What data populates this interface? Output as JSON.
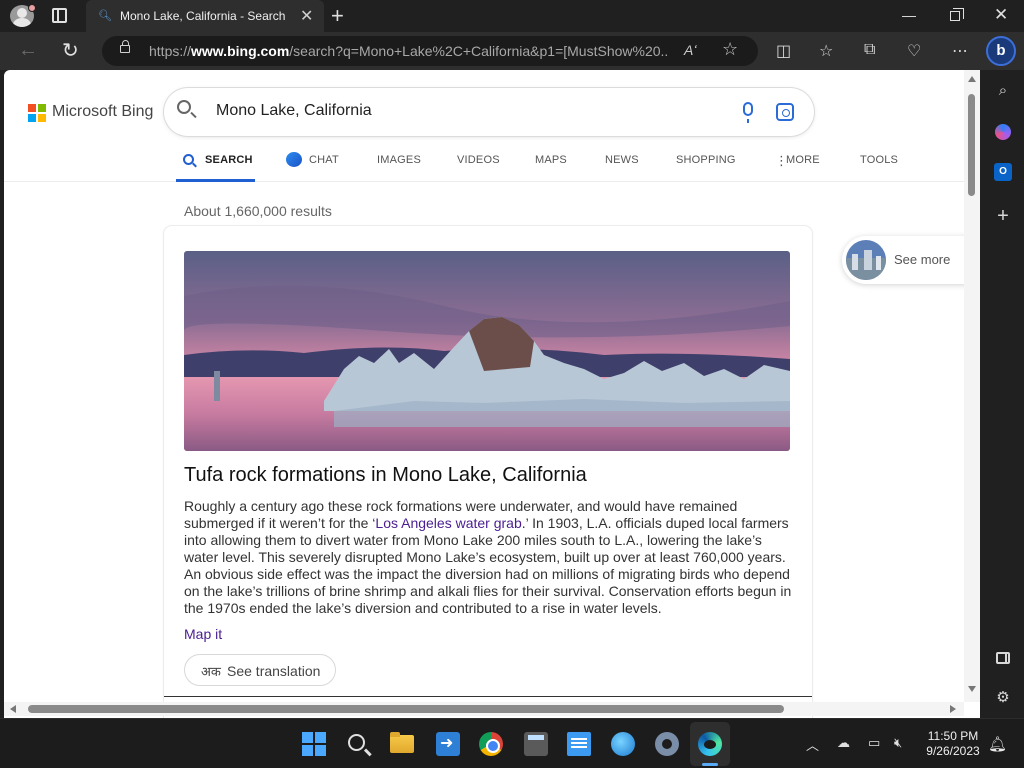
{
  "browser": {
    "tab_title": "Mono Lake, California - Search",
    "url_prefix": "https://",
    "url_domain": "www.bing.com",
    "url_rest": "/search?q=Mono+Lake%2C+California&p1=[MustShow%20...",
    "read_aloud_glyph": "Aʻ"
  },
  "bing": {
    "logo_text": "Microsoft Bing",
    "query": "Mono Lake, California",
    "scopes": {
      "search": "SEARCH",
      "chat": "CHAT",
      "images": "IMAGES",
      "videos": "VIDEOS",
      "maps": "MAPS",
      "news": "NEWS",
      "shopping": "SHOPPING",
      "more": "MORE",
      "tools": "TOOLS"
    },
    "result_count": "About 1,660,000 results",
    "card": {
      "title": "Tufa rock formations in Mono Lake, California",
      "desc_before": "Roughly a century ago these rock formations were underwater, and would have remained submerged if it weren’t for the ‘",
      "desc_link": "Los Angeles water grab",
      "desc_after": ".’ In 1903, L.A. officials duped local farmers into allowing them to divert water from Mono Lake 200 miles south to L.A., lowering the lake’s water level. This severely disrupted Mono Lake’s ecosystem, built up over at least 760,000 years. An obvious side effect was the impact the diversion had on millions of migrating birds who depend on the lake’s trillions of brine shrimp and alkali flies for their survival. Conservation efforts begun in the 1970s ended the lake’s diversion and contributed to a rise in water levels.",
      "map_link": "Map it",
      "translate_label": "See translation",
      "translate_icon": "अक"
    },
    "see_more": "See more"
  },
  "taskbar": {
    "time": "11:50 PM",
    "date": "9/26/2023"
  },
  "colors": {
    "accent": "#1f5fd1",
    "link": "#4a1e91",
    "browser_chrome": "#202020"
  }
}
